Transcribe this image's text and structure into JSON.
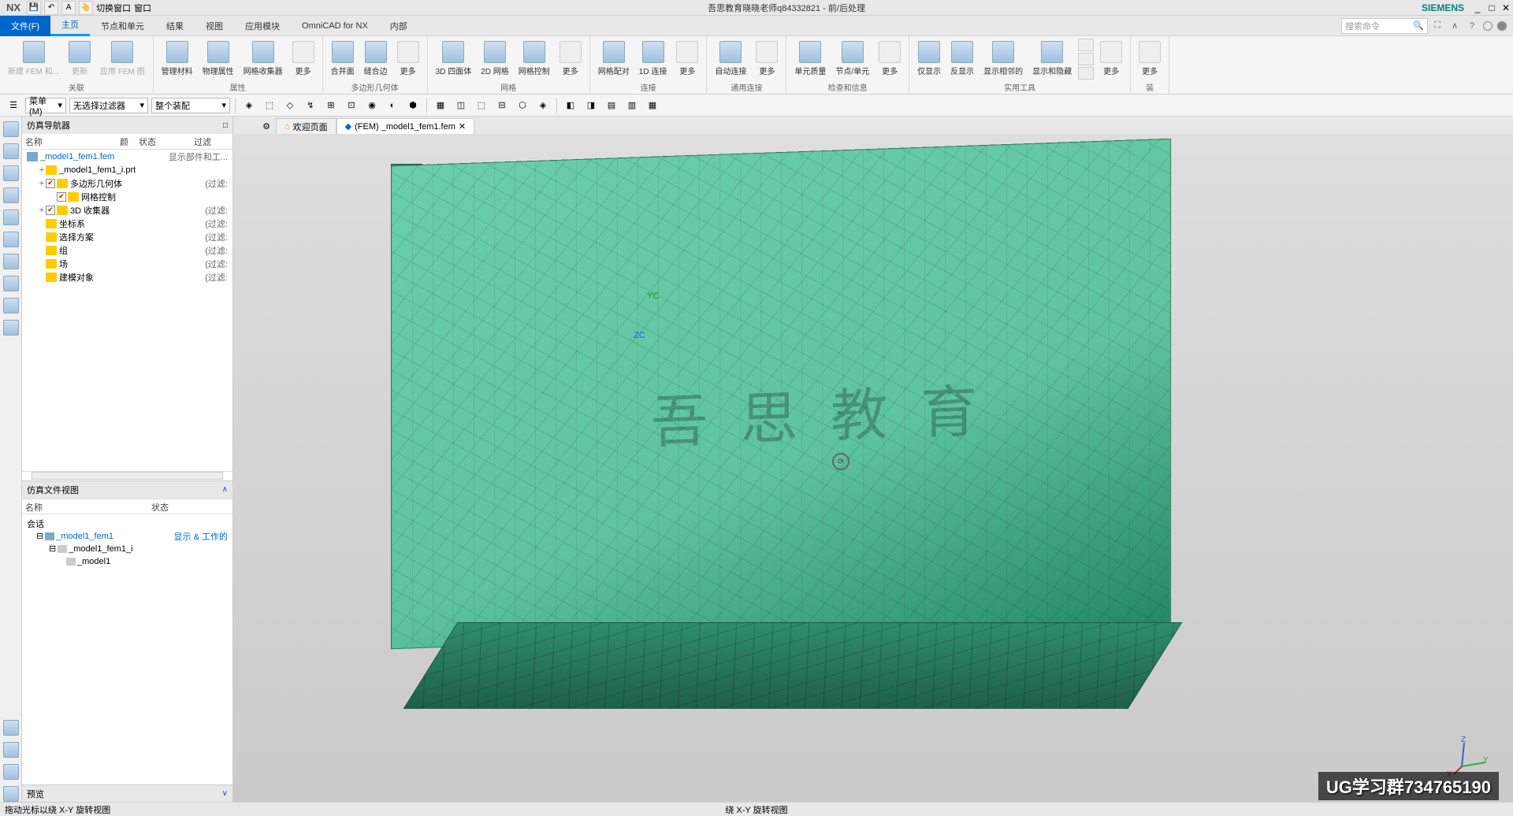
{
  "titlebar": {
    "app": "NX",
    "qat": {
      "switch_window": "切换窗口",
      "windows": "窗口"
    },
    "doc": "吾思教育晓晓老师q84332821 - 前/后处理",
    "brand": "SIEMENS"
  },
  "menu": {
    "file": "文件(F)",
    "tabs": [
      "主页",
      "节点和单元",
      "结果",
      "视图",
      "应用模块",
      "OmniCAD for NX",
      "内部"
    ],
    "active": "主页",
    "search_placeholder": "搜索命令"
  },
  "ribbon": {
    "groups": [
      {
        "label": "关联",
        "buttons": [
          {
            "id": "b1",
            "lbl": "新建\nFEM 和..."
          },
          {
            "id": "b2",
            "lbl": "更新"
          },
          {
            "id": "b3",
            "lbl": "应用\nFEM 图"
          }
        ]
      },
      {
        "label": "属性",
        "buttons": [
          {
            "id": "b4",
            "lbl": "管理材料"
          },
          {
            "id": "b5",
            "lbl": "物理属性"
          },
          {
            "id": "b6",
            "lbl": "网格收集器"
          },
          {
            "id": "b7",
            "lbl": "更多"
          }
        ]
      },
      {
        "label": "多边形几何体",
        "buttons": [
          {
            "id": "b8",
            "lbl": "合并面"
          },
          {
            "id": "b9",
            "lbl": "缝合边"
          },
          {
            "id": "b10",
            "lbl": "更多"
          }
        ]
      },
      {
        "label": "网格",
        "buttons": [
          {
            "id": "b11",
            "lbl": "3D 四面体"
          },
          {
            "id": "b12",
            "lbl": "2D 网格"
          },
          {
            "id": "b13",
            "lbl": "网格控制"
          },
          {
            "id": "b14",
            "lbl": "更多"
          }
        ]
      },
      {
        "label": "连接",
        "buttons": [
          {
            "id": "b15",
            "lbl": "网格配对"
          },
          {
            "id": "b16",
            "lbl": "1D 连接"
          },
          {
            "id": "b17",
            "lbl": "更多"
          }
        ]
      },
      {
        "label": "通用连接",
        "buttons": [
          {
            "id": "b18",
            "lbl": "自动连接"
          },
          {
            "id": "b19",
            "lbl": "更多"
          }
        ]
      },
      {
        "label": "检查和信息",
        "buttons": [
          {
            "id": "b20",
            "lbl": "单元质量"
          },
          {
            "id": "b21",
            "lbl": "节点/单元"
          },
          {
            "id": "b22",
            "lbl": "更多"
          }
        ]
      },
      {
        "label": "实用工具",
        "buttons": [
          {
            "id": "b23",
            "lbl": "仅显示"
          },
          {
            "id": "b24",
            "lbl": "反显示"
          },
          {
            "id": "b25",
            "lbl": "显示相邻的"
          },
          {
            "id": "b26",
            "lbl": "显示和隐藏"
          },
          {
            "id": "b27",
            "lbl": "更多"
          }
        ]
      },
      {
        "label": "装 ",
        "buttons": [
          {
            "id": "b28",
            "lbl": "更多"
          }
        ]
      }
    ]
  },
  "tb2": {
    "menu_label": "菜单(M)",
    "filter1": "无选择过滤器",
    "filter2": "整个装配"
  },
  "navigator": {
    "title": "仿真导航器",
    "cols": {
      "name": "名称",
      "color": "颜",
      "status": "状态",
      "filter": "过滤"
    },
    "top_item": "_model1_fem1.fem",
    "top_status": "显示部件和工...",
    "items": [
      {
        "indent": 1,
        "twisty": "+",
        "chk": false,
        "ico": "folder-icon",
        "label": "_model1_fem1_i.prt",
        "right": ""
      },
      {
        "indent": 1,
        "twisty": "+",
        "chk": true,
        "ico": "poly-icon",
        "label": "多边形几何体",
        "right": "(过滤: "
      },
      {
        "indent": 2,
        "twisty": "",
        "chk": true,
        "ico": "mesh-ctrl-icon",
        "label": "网格控制",
        "right": ""
      },
      {
        "indent": 1,
        "twisty": "+",
        "chk": true,
        "ico": "collector-icon",
        "label": "3D 收集器",
        "right": "(过滤: "
      },
      {
        "indent": 1,
        "twisty": "",
        "chk": false,
        "ico": "csys-icon",
        "label": "坐标系",
        "right": "(过滤: "
      },
      {
        "indent": 1,
        "twisty": "",
        "chk": false,
        "ico": "scheme-icon",
        "label": "选择方案",
        "right": "(过滤: "
      },
      {
        "indent": 1,
        "twisty": "",
        "chk": false,
        "ico": "group-icon",
        "label": "组",
        "right": "(过滤: "
      },
      {
        "indent": 1,
        "twisty": "",
        "chk": false,
        "ico": "field-icon",
        "label": "场",
        "right": "(过滤: "
      },
      {
        "indent": 1,
        "twisty": "",
        "chk": false,
        "ico": "model-obj-icon",
        "label": "建模对象",
        "right": "(过滤: "
      }
    ]
  },
  "file_view": {
    "title": "仿真文件视图",
    "cols": {
      "name": "名称",
      "status": "状态"
    },
    "session": "会话",
    "items": [
      {
        "indent": 1,
        "label": "_model1_fem1",
        "status": "显示 & 工作的"
      },
      {
        "indent": 2,
        "label": "_model1_fem1_i",
        "status": ""
      },
      {
        "indent": 3,
        "label": "_model1",
        "status": ""
      }
    ],
    "preview": "预览"
  },
  "doc_tabs": {
    "welcome": "欢迎页面",
    "active": "(FEM) _model1_fem1.fem"
  },
  "canvas": {
    "yc": "YC",
    "zc": "ZC",
    "mesh_text": "吾 思 教 育",
    "triad": {
      "x": "X",
      "y": "Y",
      "z": "Z"
    }
  },
  "watermark": "UG学习群734765190",
  "status": {
    "left": "拖动光标以绕 X-Y 旋转视图",
    "center": "绕 X-Y 旋转视图"
  }
}
